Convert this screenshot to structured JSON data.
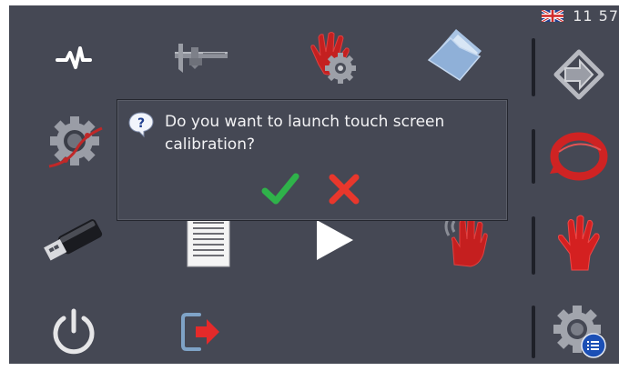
{
  "status_bar": {
    "language_flag": "uk-flag-icon",
    "clock": "11 57"
  },
  "menu": {
    "icons": [
      "pulse-icon",
      "caliper-icon",
      "hand-gear-icon",
      "folder-icon",
      "gear-measure-icon",
      "usb-drive-icon",
      "document-icon",
      "play-icon",
      "touch-hand-icon",
      "power-icon",
      "logout-icon"
    ]
  },
  "side_panel": {
    "icons": [
      "next-arrow-icon",
      "refresh-icon",
      "red-glove-icon",
      "settings-list-icon"
    ]
  },
  "dialog": {
    "icon": "question-icon",
    "message": "Do you want to launch touch screen calibration?",
    "confirm_icon": "checkmark-icon",
    "cancel_icon": "cross-icon",
    "colors": {
      "confirm": "#2fb24a",
      "cancel": "#e8372c"
    }
  }
}
